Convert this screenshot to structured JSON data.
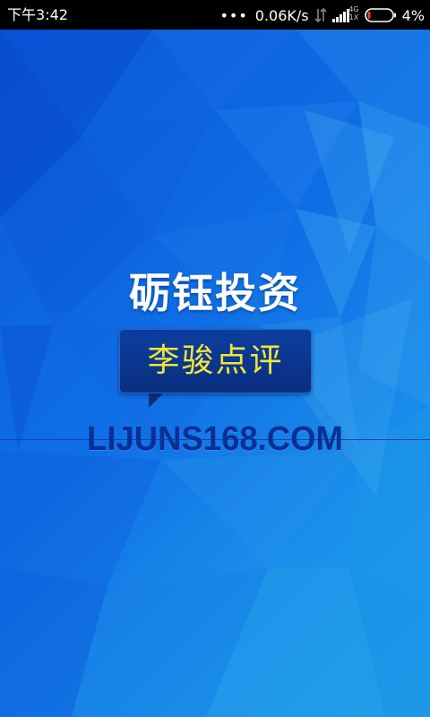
{
  "status_bar": {
    "time": "下午3:42",
    "dots": "•••",
    "net_speed": "0.06K/s",
    "network_type_top": "4G",
    "network_type_bottom": "1X",
    "battery_percent": "4%",
    "icons": [
      "more-dots-icon",
      "data-arrows-icon",
      "signal-icon",
      "battery-icon"
    ]
  },
  "splash": {
    "title": "砺钰投资",
    "bubble_text": "李骏点评",
    "website": "LIJUNS168.COM"
  },
  "colors": {
    "background_blue": "#0a5fdc",
    "title_white": "#ffffff",
    "bubble_navy": "#0a2f7f",
    "bubble_text_yellow": "#f3e53a",
    "url_navy": "#0a2f96"
  }
}
